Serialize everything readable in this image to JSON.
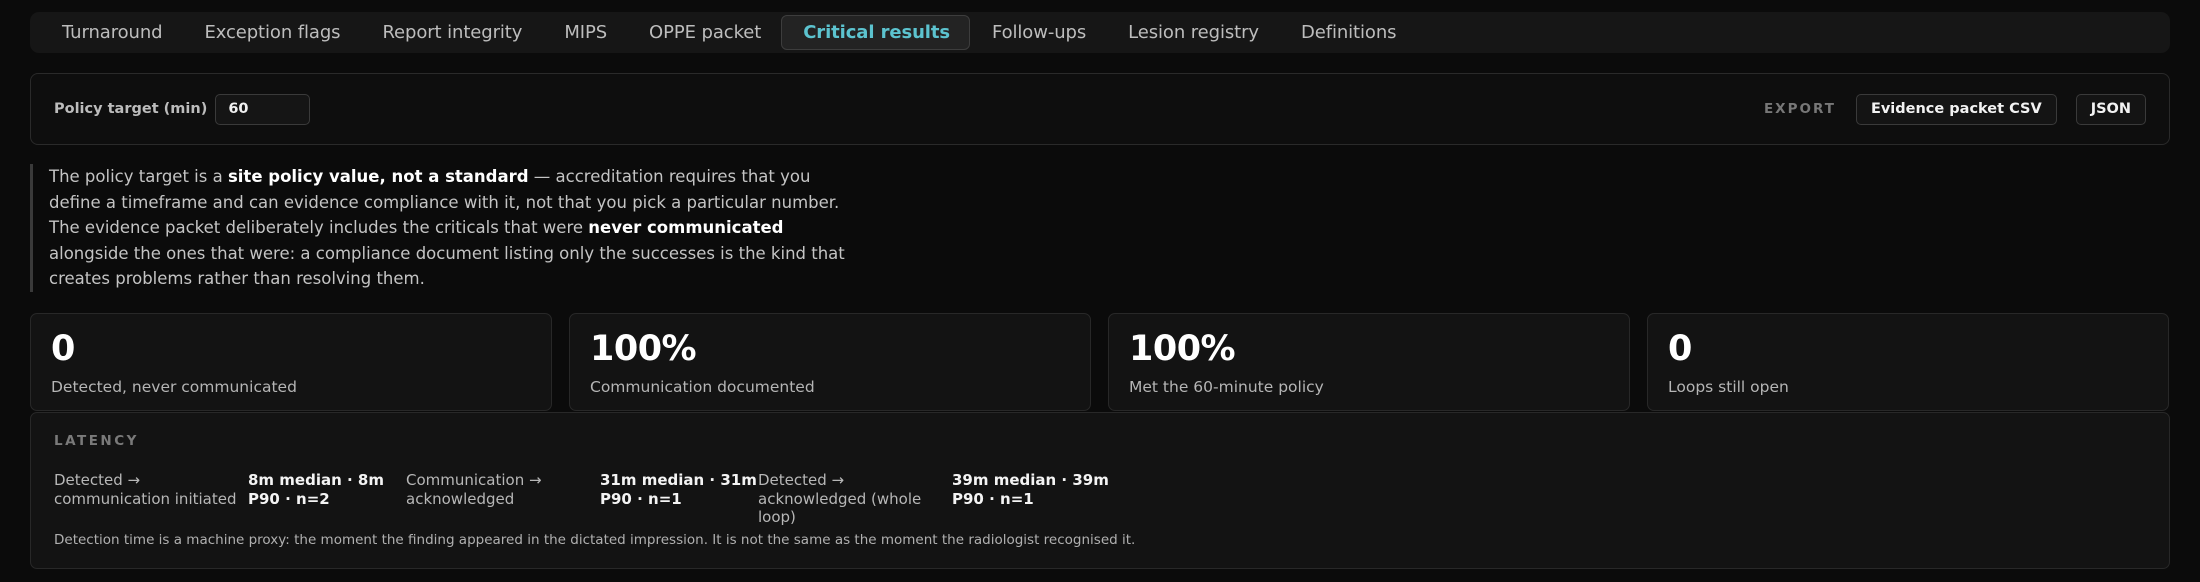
{
  "tabs": [
    {
      "label": "Turnaround",
      "active": false
    },
    {
      "label": "Exception flags",
      "active": false
    },
    {
      "label": "Report integrity",
      "active": false
    },
    {
      "label": "MIPS",
      "active": false
    },
    {
      "label": "OPPE packet",
      "active": false
    },
    {
      "label": "Critical results",
      "active": true
    },
    {
      "label": "Follow-ups",
      "active": false
    },
    {
      "label": "Lesion registry",
      "active": false
    },
    {
      "label": "Definitions",
      "active": false
    }
  ],
  "policy": {
    "label": "Policy target (min)",
    "value": "60",
    "export_label": "EXPORT",
    "csv_button": "Evidence packet CSV",
    "json_button": "JSON"
  },
  "note": {
    "t1": "The policy target is a ",
    "b1": "site policy value, not a standard",
    "t2": " — accreditation requires that you define a timeframe and can evidence compliance with it, not that you pick a particular number. The evidence packet deliberately includes the criticals that were ",
    "b2": "never communicated",
    "t3": " alongside the ones that were: a compliance document listing only the successes is the kind that creates problems rather than resolving them."
  },
  "stats": [
    {
      "value": "0",
      "label": "Detected, never communicated"
    },
    {
      "value": "100%",
      "label": "Communication documented"
    },
    {
      "value": "100%",
      "label": "Met the 60-minute policy"
    },
    {
      "value": "0",
      "label": "Loops still open"
    }
  ],
  "latency": {
    "title": "LATENCY",
    "items": [
      {
        "key": "Detected → communication initiated",
        "value": "8m median · 8m P90 · n=2"
      },
      {
        "key": "Communication → acknowledged",
        "value": "31m median · 31m P90 · n=1"
      },
      {
        "key": "Detected → acknowledged (whole loop)",
        "value": "39m median · 39m P90 · n=1"
      }
    ],
    "footnote": "Detection time is a machine proxy: the moment the finding appeared in the dictated impression. It is not the same as the moment the radiologist recognised it."
  },
  "colors": {
    "accent": "#5cc3cf",
    "background": "#0b0b0b",
    "panel": "#131313"
  }
}
